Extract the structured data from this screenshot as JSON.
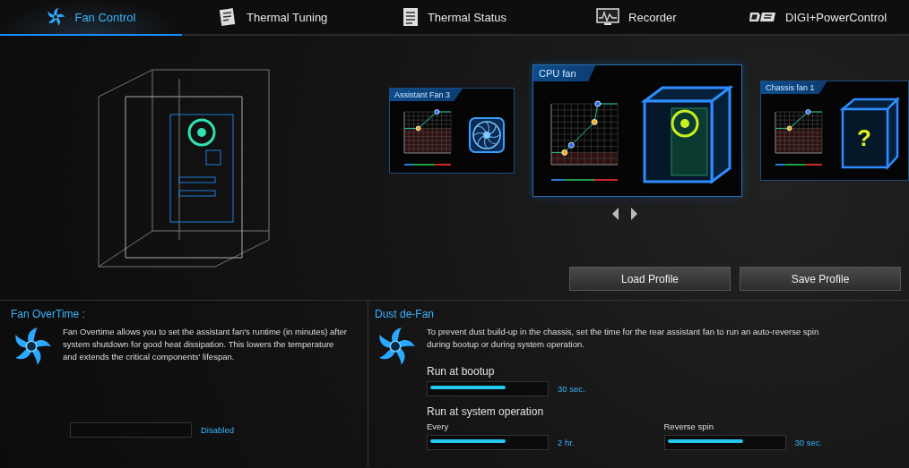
{
  "tabs": [
    {
      "label": "Fan Control",
      "selected": true,
      "kind": "fan"
    },
    {
      "label": "Thermal Tuning",
      "selected": false,
      "kind": "tuning"
    },
    {
      "label": "Thermal Status",
      "selected": false,
      "kind": "status"
    },
    {
      "label": "Recorder",
      "selected": false,
      "kind": "recorder"
    },
    {
      "label": "DIGI+PowerControl",
      "selected": false,
      "kind": "digi"
    }
  ],
  "fan_cards": [
    {
      "title": "Assistant Fan 3",
      "selected": false,
      "kind": "fan"
    },
    {
      "title": "CPU fan",
      "selected": true,
      "kind": "case"
    },
    {
      "title": "Chassis fan 1",
      "selected": false,
      "kind": "unknown",
      "mark": "?"
    }
  ],
  "profile_buttons": [
    "Load Profile",
    "Save Profile"
  ],
  "fan_overtime": {
    "title": "Fan OverTime :",
    "description": "Fan Overtime allows you to set the assistant fan's runtime (in minutes) after system shutdown for good heat dissipation. This lowers the temperature and extends the critical components' lifespan.",
    "slider": {
      "reading": "Disabled"
    }
  },
  "dust_defan": {
    "title": "Dust de-Fan",
    "description": "To prevent dust build-up in the chassis, set the time for  the rear assistant fan to run an auto-reverse spin during bootup or during system operation.",
    "bootup": {
      "heading": "Run at bootup",
      "level": 0.66,
      "reading": "30 sec."
    },
    "system_operation": {
      "heading": "Run at system operation",
      "every": {
        "label": "Every",
        "level": 0.66,
        "reading": "2 hr."
      },
      "reverse_spin": {
        "label": "Reverse spin",
        "level": 0.66,
        "reading": "30 sec."
      }
    }
  }
}
